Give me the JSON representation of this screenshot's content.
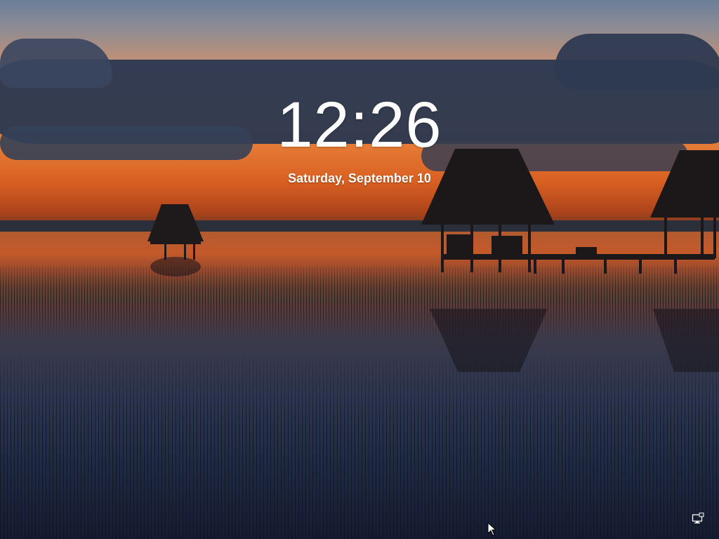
{
  "lock_screen": {
    "time": "12:26",
    "date": "Saturday, September 10"
  },
  "background": {
    "scene": "sunset-lake-with-thatched-huts",
    "colors": {
      "sky_top": "#6b7e98",
      "sky_orange": "#e47a34",
      "clouds": "#2b3850",
      "water_dark": "#141c30"
    }
  },
  "system_tray": {
    "network_icon": "network-monitor-icon"
  },
  "pointer": {
    "icon": "mouse-cursor-icon"
  }
}
